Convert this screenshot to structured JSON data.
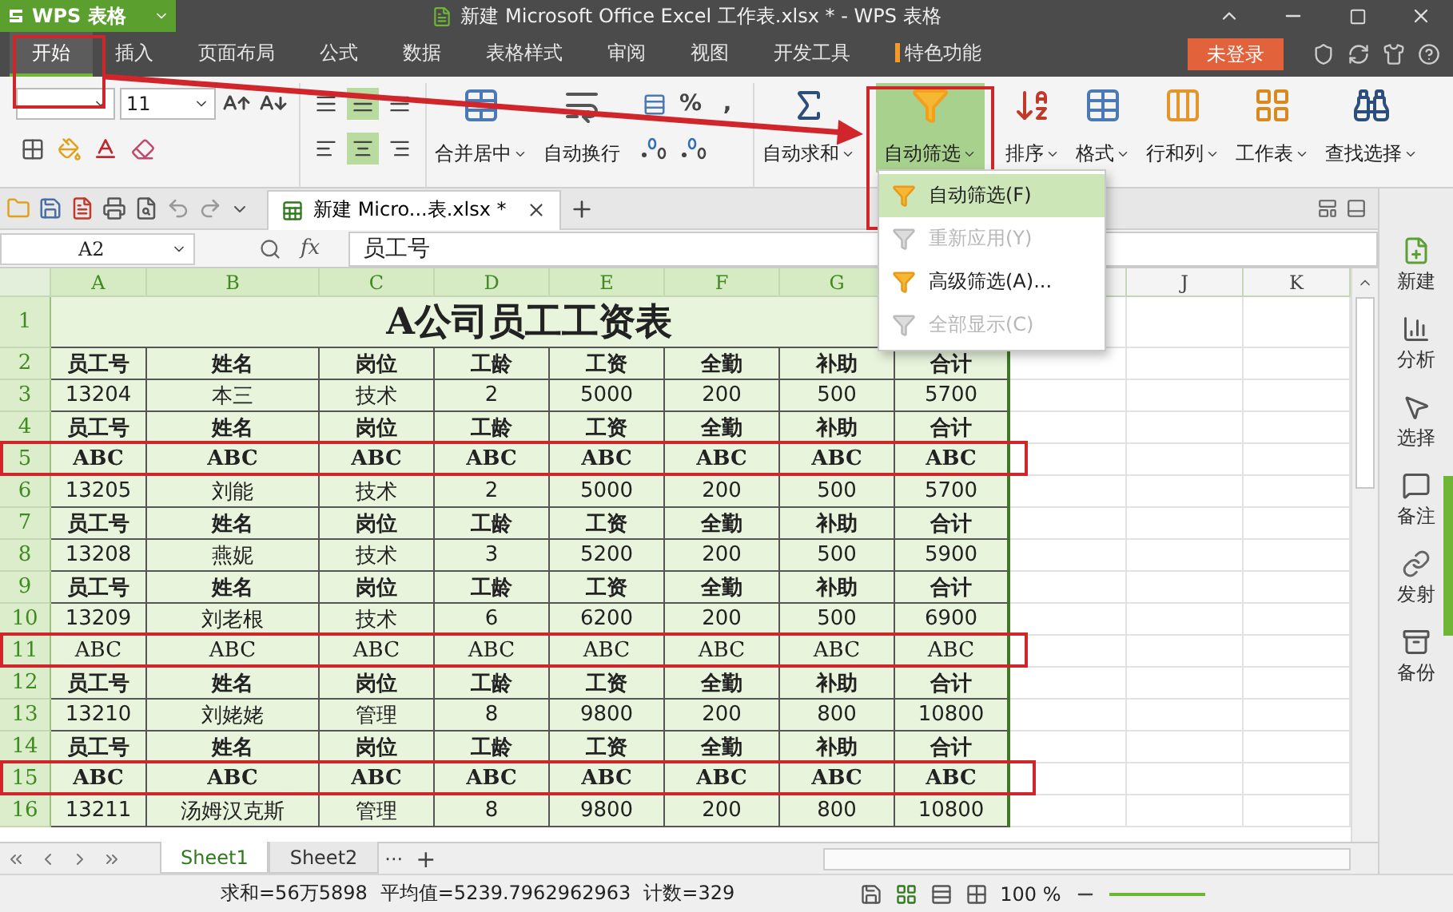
{
  "window": {
    "app_button": "WPS 表格",
    "title": "新建 Microsoft Office Excel 工作表.xlsx * - WPS 表格"
  },
  "menu": {
    "tabs": [
      {
        "label": "开始",
        "selected": true,
        "annotated": true,
        "marker": false
      },
      {
        "label": "插入",
        "selected": false,
        "annotated": false,
        "marker": false
      },
      {
        "label": "页面布局",
        "selected": false,
        "annotated": false,
        "marker": false
      },
      {
        "label": "公式",
        "selected": false,
        "annotated": false,
        "marker": false
      },
      {
        "label": "数据",
        "selected": false,
        "annotated": false,
        "marker": false
      },
      {
        "label": "表格样式",
        "selected": false,
        "annotated": false,
        "marker": false
      },
      {
        "label": "审阅",
        "selected": false,
        "annotated": false,
        "marker": false
      },
      {
        "label": "视图",
        "selected": false,
        "annotated": false,
        "marker": false
      },
      {
        "label": "开发工具",
        "selected": false,
        "annotated": false,
        "marker": false
      },
      {
        "label": "特色功能",
        "selected": false,
        "annotated": false,
        "marker": true
      }
    ],
    "login_button": "未登录"
  },
  "ribbon": {
    "font_size": "11",
    "symbols": [
      "%",
      ","
    ],
    "buttons": [
      {
        "label": "合并居中",
        "dropdown": true,
        "selected": false,
        "annotated": false
      },
      {
        "label": "自动换行",
        "dropdown": false,
        "selected": false,
        "annotated": false
      },
      {
        "label": "自动求和",
        "dropdown": true,
        "selected": false,
        "annotated": false
      },
      {
        "label": "自动筛选",
        "dropdown": true,
        "selected": true,
        "annotated": true
      },
      {
        "label": "排序",
        "dropdown": true,
        "selected": false,
        "annotated": false
      },
      {
        "label": "格式",
        "dropdown": true,
        "selected": false,
        "annotated": false
      },
      {
        "label": "行和列",
        "dropdown": true,
        "selected": false,
        "annotated": false
      },
      {
        "label": "工作表",
        "dropdown": true,
        "selected": false,
        "annotated": false
      },
      {
        "label": "查找选择",
        "dropdown": true,
        "selected": false,
        "annotated": false
      }
    ]
  },
  "filter_menu": {
    "items": [
      {
        "label": "自动筛选(F)",
        "disabled": false,
        "selected": true
      },
      {
        "label": "重新应用(Y)",
        "disabled": true,
        "selected": false
      },
      {
        "label": "高级筛选(A)...",
        "disabled": false,
        "selected": false
      },
      {
        "label": "全部显示(C)",
        "disabled": true,
        "selected": false
      }
    ]
  },
  "document_tab": {
    "label": "新建 Micro...表.xlsx *"
  },
  "formula_bar": {
    "cell": "A2",
    "fx": "fx",
    "value": "员工号"
  },
  "columns": [
    "A",
    "B",
    "C",
    "D",
    "E",
    "F",
    "G",
    "J",
    "K"
  ],
  "rows": [
    {
      "number": "1",
      "kind": "title",
      "text": "A公司员工工资表",
      "annotated": false
    },
    {
      "number": "2",
      "kind": "cells",
      "bold": true,
      "annotated": false,
      "cells": [
        "员工号",
        "姓名",
        "岗位",
        "工龄",
        "工资",
        "全勤",
        "补助",
        "合计"
      ]
    },
    {
      "number": "3",
      "kind": "cells",
      "bold": false,
      "annotated": false,
      "cells": [
        "13204",
        "本三",
        "技术",
        "2",
        "5000",
        "200",
        "500",
        "5700"
      ]
    },
    {
      "number": "4",
      "kind": "cells",
      "bold": true,
      "annotated": false,
      "cells": [
        "员工号",
        "姓名",
        "岗位",
        "工龄",
        "工资",
        "全勤",
        "补助",
        "合计"
      ]
    },
    {
      "number": "5",
      "kind": "cells",
      "bold": true,
      "annotated": true,
      "cells": [
        "ABC",
        "ABC",
        "ABC",
        "ABC",
        "ABC",
        "ABC",
        "ABC",
        "ABC"
      ]
    },
    {
      "number": "6",
      "kind": "cells",
      "bold": false,
      "annotated": false,
      "cells": [
        "13205",
        "刘能",
        "技术",
        "2",
        "5000",
        "200",
        "500",
        "5700"
      ]
    },
    {
      "number": "7",
      "kind": "cells",
      "bold": true,
      "annotated": false,
      "cells": [
        "员工号",
        "姓名",
        "岗位",
        "工龄",
        "工资",
        "全勤",
        "补助",
        "合计"
      ]
    },
    {
      "number": "8",
      "kind": "cells",
      "bold": false,
      "annotated": false,
      "cells": [
        "13208",
        "燕妮",
        "技术",
        "3",
        "5200",
        "200",
        "500",
        "5900"
      ]
    },
    {
      "number": "9",
      "kind": "cells",
      "bold": true,
      "annotated": false,
      "cells": [
        "员工号",
        "姓名",
        "岗位",
        "工龄",
        "工资",
        "全勤",
        "补助",
        "合计"
      ]
    },
    {
      "number": "10",
      "kind": "cells",
      "bold": false,
      "annotated": false,
      "cells": [
        "13209",
        "刘老根",
        "技术",
        "6",
        "6200",
        "200",
        "500",
        "6900"
      ]
    },
    {
      "number": "11",
      "kind": "cells",
      "bold": false,
      "annotated": true,
      "cells": [
        "ABC",
        "ABC",
        "ABC",
        "ABC",
        "ABC",
        "ABC",
        "ABC",
        "ABC"
      ]
    },
    {
      "number": "12",
      "kind": "cells",
      "bold": true,
      "annotated": false,
      "cells": [
        "员工号",
        "姓名",
        "岗位",
        "工龄",
        "工资",
        "全勤",
        "补助",
        "合计"
      ]
    },
    {
      "number": "13",
      "kind": "cells",
      "bold": false,
      "annotated": false,
      "cells": [
        "13210",
        "刘姥姥",
        "管理",
        "8",
        "9800",
        "200",
        "800",
        "10800"
      ]
    },
    {
      "number": "14",
      "kind": "cells",
      "bold": true,
      "annotated": false,
      "cells": [
        "员工号",
        "姓名",
        "岗位",
        "工龄",
        "工资",
        "全勤",
        "补助",
        "合计"
      ]
    },
    {
      "number": "15",
      "kind": "cells",
      "bold": true,
      "annotated": true,
      "cells": [
        "ABC",
        "ABC",
        "ABC",
        "ABC",
        "ABC",
        "ABC",
        "ABC",
        "ABC"
      ]
    },
    {
      "number": "16",
      "kind": "cells",
      "bold": false,
      "annotated": false,
      "cells": [
        "13211",
        "汤姆汉克斯",
        "管理",
        "8",
        "9800",
        "200",
        "800",
        "10800"
      ]
    }
  ],
  "sidebar": {
    "items": [
      "新建",
      "分析",
      "选择",
      "备注",
      "发射",
      "备份"
    ]
  },
  "sheet_tabs": {
    "tabs": [
      {
        "label": "Sheet1",
        "selected": true
      },
      {
        "label": "Sheet2",
        "selected": false
      }
    ],
    "more": "···",
    "add": "+"
  },
  "status_bar": {
    "stats": [
      "求和=56万5898",
      "平均值=5239.7962962963",
      "计数=329"
    ],
    "zoom": "100 %"
  }
}
